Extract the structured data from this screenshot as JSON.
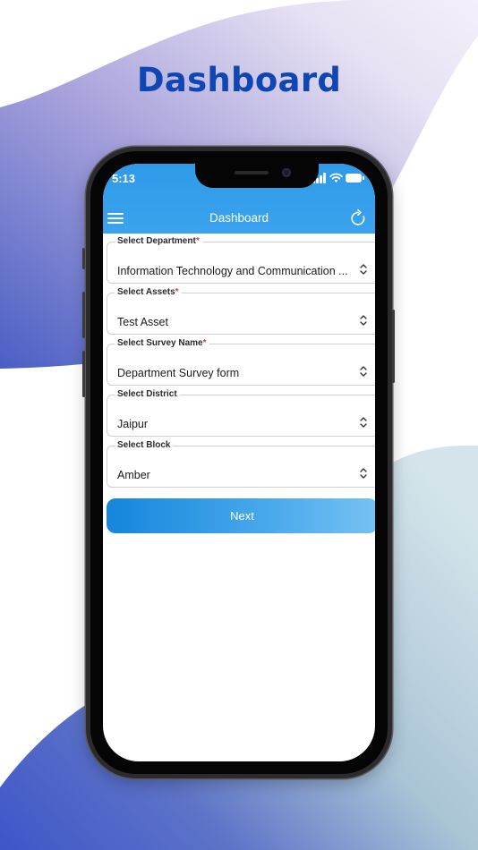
{
  "promo": {
    "title": "Dashboard"
  },
  "status_bar": {
    "time": "5:13"
  },
  "appbar": {
    "title": "Dashboard"
  },
  "form": {
    "fields": [
      {
        "label": "Select Department",
        "required": true,
        "value": "Information Technology and Communication ..."
      },
      {
        "label": "Select Assets",
        "required": true,
        "value": "Test Asset"
      },
      {
        "label": "Select Survey Name",
        "required": true,
        "value": "Department Survey form"
      },
      {
        "label": "Select District",
        "required": false,
        "value": "Jaipur"
      },
      {
        "label": "Select Block",
        "required": false,
        "value": "Amber"
      }
    ],
    "required_marker": "*",
    "next_label": "Next"
  },
  "colors": {
    "title_blue": "#0f46b4",
    "appbar_blue": "#3ba3ee",
    "required_red": "#e53935"
  }
}
